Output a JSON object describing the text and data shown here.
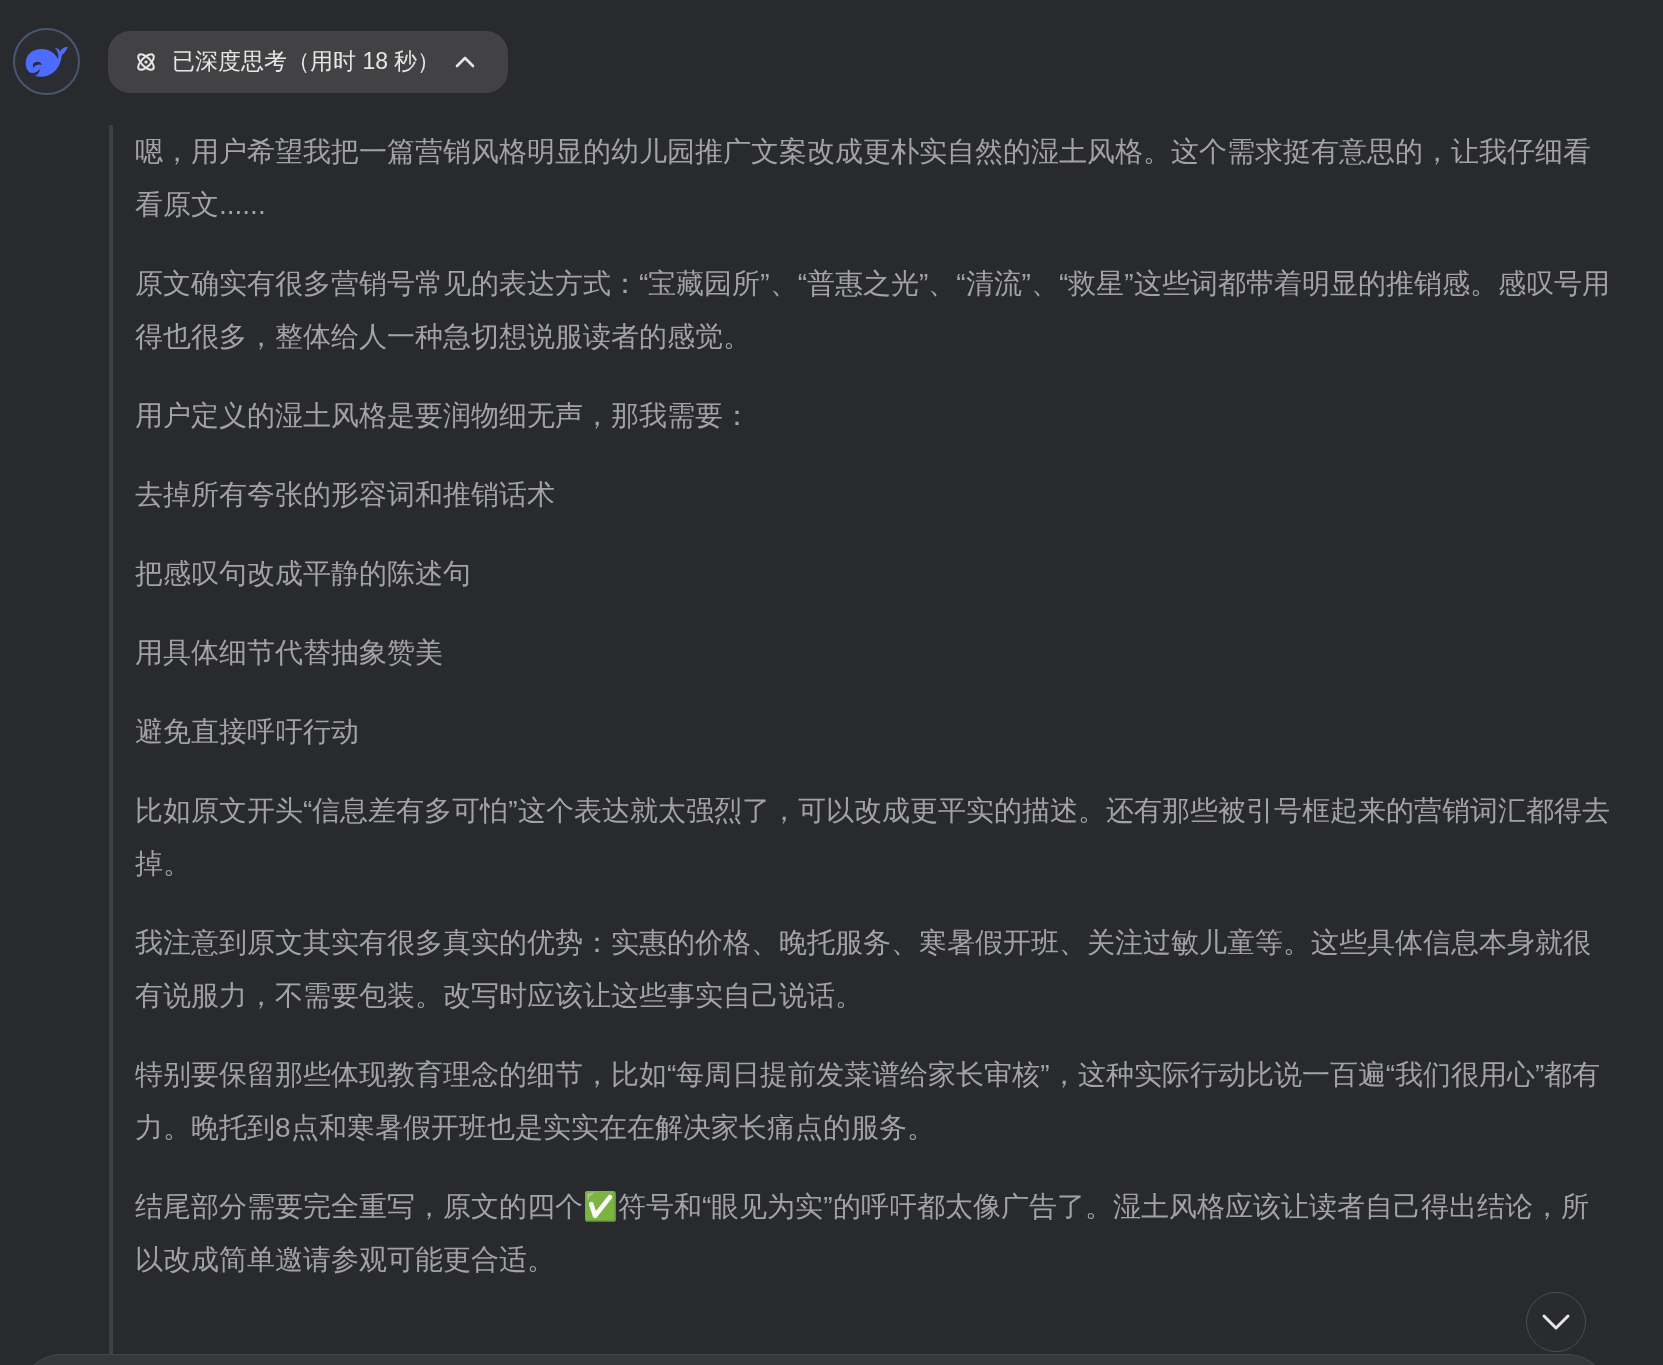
{
  "header": {
    "label": "已深度思考（用时 18 秒）",
    "expanded": true
  },
  "thought": {
    "paragraphs": [
      "嗯，用户希望我把一篇营销风格明显的幼儿园推广文案改成更朴实自然的湿土风格。这个需求挺有意思的，让我仔细看看原文......",
      "原文确实有很多营销号常见的表达方式：“宝藏园所”、“普惠之光”、“清流”、“救星”这些词都带着明显的推销感。感叹号用得也很多，整体给人一种急切想说服读者的感觉。",
      "用户定义的湿土风格是要润物细无声，那我需要：",
      "去掉所有夸张的形容词和推销话术",
      "把感叹句改成平静的陈述句",
      "用具体细节代替抽象赞美",
      "避免直接呼吁行动",
      "比如原文开头“信息差有多可怕”这个表达就太强烈了，可以改成更平实的描述。还有那些被引号框起来的营销词汇都得去掉。",
      "我注意到原文其实有很多真实的优势：实惠的价格、晚托服务、寒暑假开班、关注过敏儿童等。这些具体信息本身就很有说服力，不需要包装。改写时应该让这些事实自己说话。",
      "特别要保留那些体现教育理念的细节，比如“每周日提前发菜谱给家长审核”，这种实际行动比说一百遍“我们很用心”都有力。晚托到8点和寒暑假开班也是实实在在解决家长痛点的服务。",
      "结尾部分需要完全重写，原文的四个✅符号和“眼见为实”的呼吁都太像广告了。湿土风格应该让读者自己得出结论，所以改成简单邀请参观可能更合适。"
    ]
  }
}
